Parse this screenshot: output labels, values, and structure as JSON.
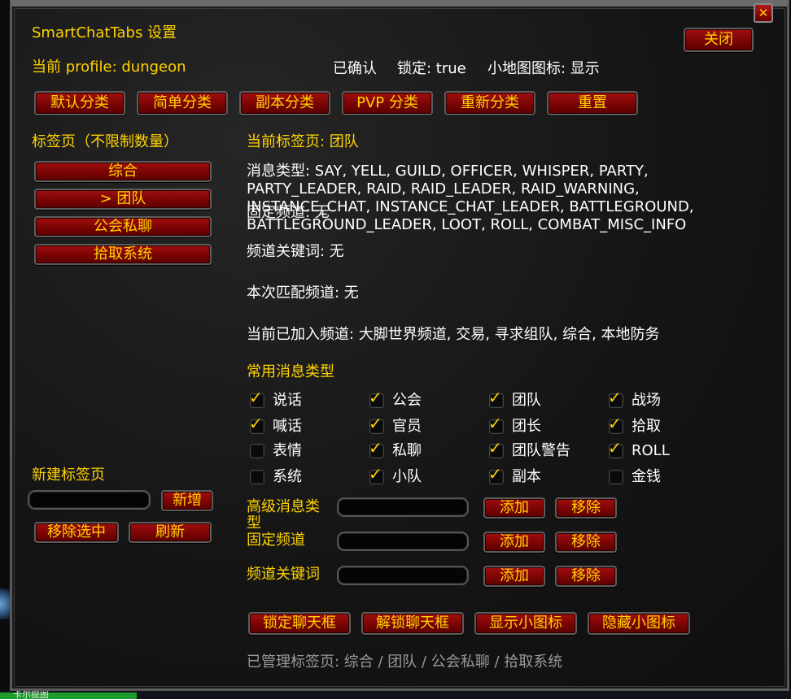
{
  "window": {
    "title": "SmartChatTabs 设置",
    "close_label": "关闭",
    "close_x": "✕"
  },
  "status": {
    "profile": "当前 profile: dungeon",
    "confirmed": "已确认",
    "lock": "锁定: true",
    "minimap": "小地图图标: 显示"
  },
  "presets": [
    "默认分类",
    "简单分类",
    "副本分类",
    "PVP 分类",
    "重新分类",
    "重置"
  ],
  "tabs": {
    "heading": "标签页（不限制数量）",
    "items": [
      "综合",
      "> 团队",
      "公会私聊",
      "拾取系统"
    ]
  },
  "new_tab": {
    "heading": "新建标签页",
    "input_value": "",
    "add_label": "新增",
    "remove_selected_label": "移除选中",
    "refresh_label": "刷新"
  },
  "details": {
    "current_tab": "当前标签页: 团队",
    "message_types_lines": [
      "消息类型: SAY, YELL, GUILD, OFFICER, WHISPER, PARTY,",
      "PARTY_LEADER, RAID, RAID_LEADER, RAID_WARNING,",
      "INSTANCE_CHAT, INSTANCE_CHAT_LEADER, BATTLEGROUND,",
      "BATTLEGROUND_LEADER, LOOT, ROLL, COMBAT_MISC_INFO"
    ],
    "fixed_channels": "固定频道: 无",
    "channel_keywords": "频道关键词: 无",
    "matched_channels": "本次匹配频道: 无",
    "joined_channels": "当前已加入频道: 大脚世界频道, 交易, 寻求组队, 综合, 本地防务"
  },
  "common_types": {
    "heading": "常用消息类型",
    "items": [
      {
        "label": "说话",
        "checked": true
      },
      {
        "label": "公会",
        "checked": true
      },
      {
        "label": "团队",
        "checked": true
      },
      {
        "label": "战场",
        "checked": true
      },
      {
        "label": "喊话",
        "checked": true
      },
      {
        "label": "官员",
        "checked": true
      },
      {
        "label": "团长",
        "checked": true
      },
      {
        "label": "拾取",
        "checked": true
      },
      {
        "label": "表情",
        "checked": false
      },
      {
        "label": "私聊",
        "checked": true
      },
      {
        "label": "团队警告",
        "checked": true
      },
      {
        "label": "ROLL",
        "checked": true
      },
      {
        "label": "系统",
        "checked": false
      },
      {
        "label": "小队",
        "checked": true
      },
      {
        "label": "副本",
        "checked": true
      },
      {
        "label": "金钱",
        "checked": false
      }
    ]
  },
  "advanced": {
    "rows": [
      {
        "label": "高级消息类型",
        "value": "",
        "add_label": "添加",
        "remove_label": "移除"
      },
      {
        "label": "固定频道",
        "value": "",
        "add_label": "添加",
        "remove_label": "移除"
      },
      {
        "label": "频道关键词",
        "value": "",
        "add_label": "添加",
        "remove_label": "移除"
      }
    ]
  },
  "actions": [
    "锁定聊天框",
    "解锁聊天框",
    "显示小图标",
    "隐藏小图标"
  ],
  "footer": "已管理标签页: 综合 / 团队 / 公会私聊 / 拾取系统",
  "underlying": {
    "bottom_text": "卡尔提图"
  },
  "colors": {
    "gold": "#ffd200",
    "button_red": "#8a0808",
    "footer_gray": "#9a9a9a"
  }
}
